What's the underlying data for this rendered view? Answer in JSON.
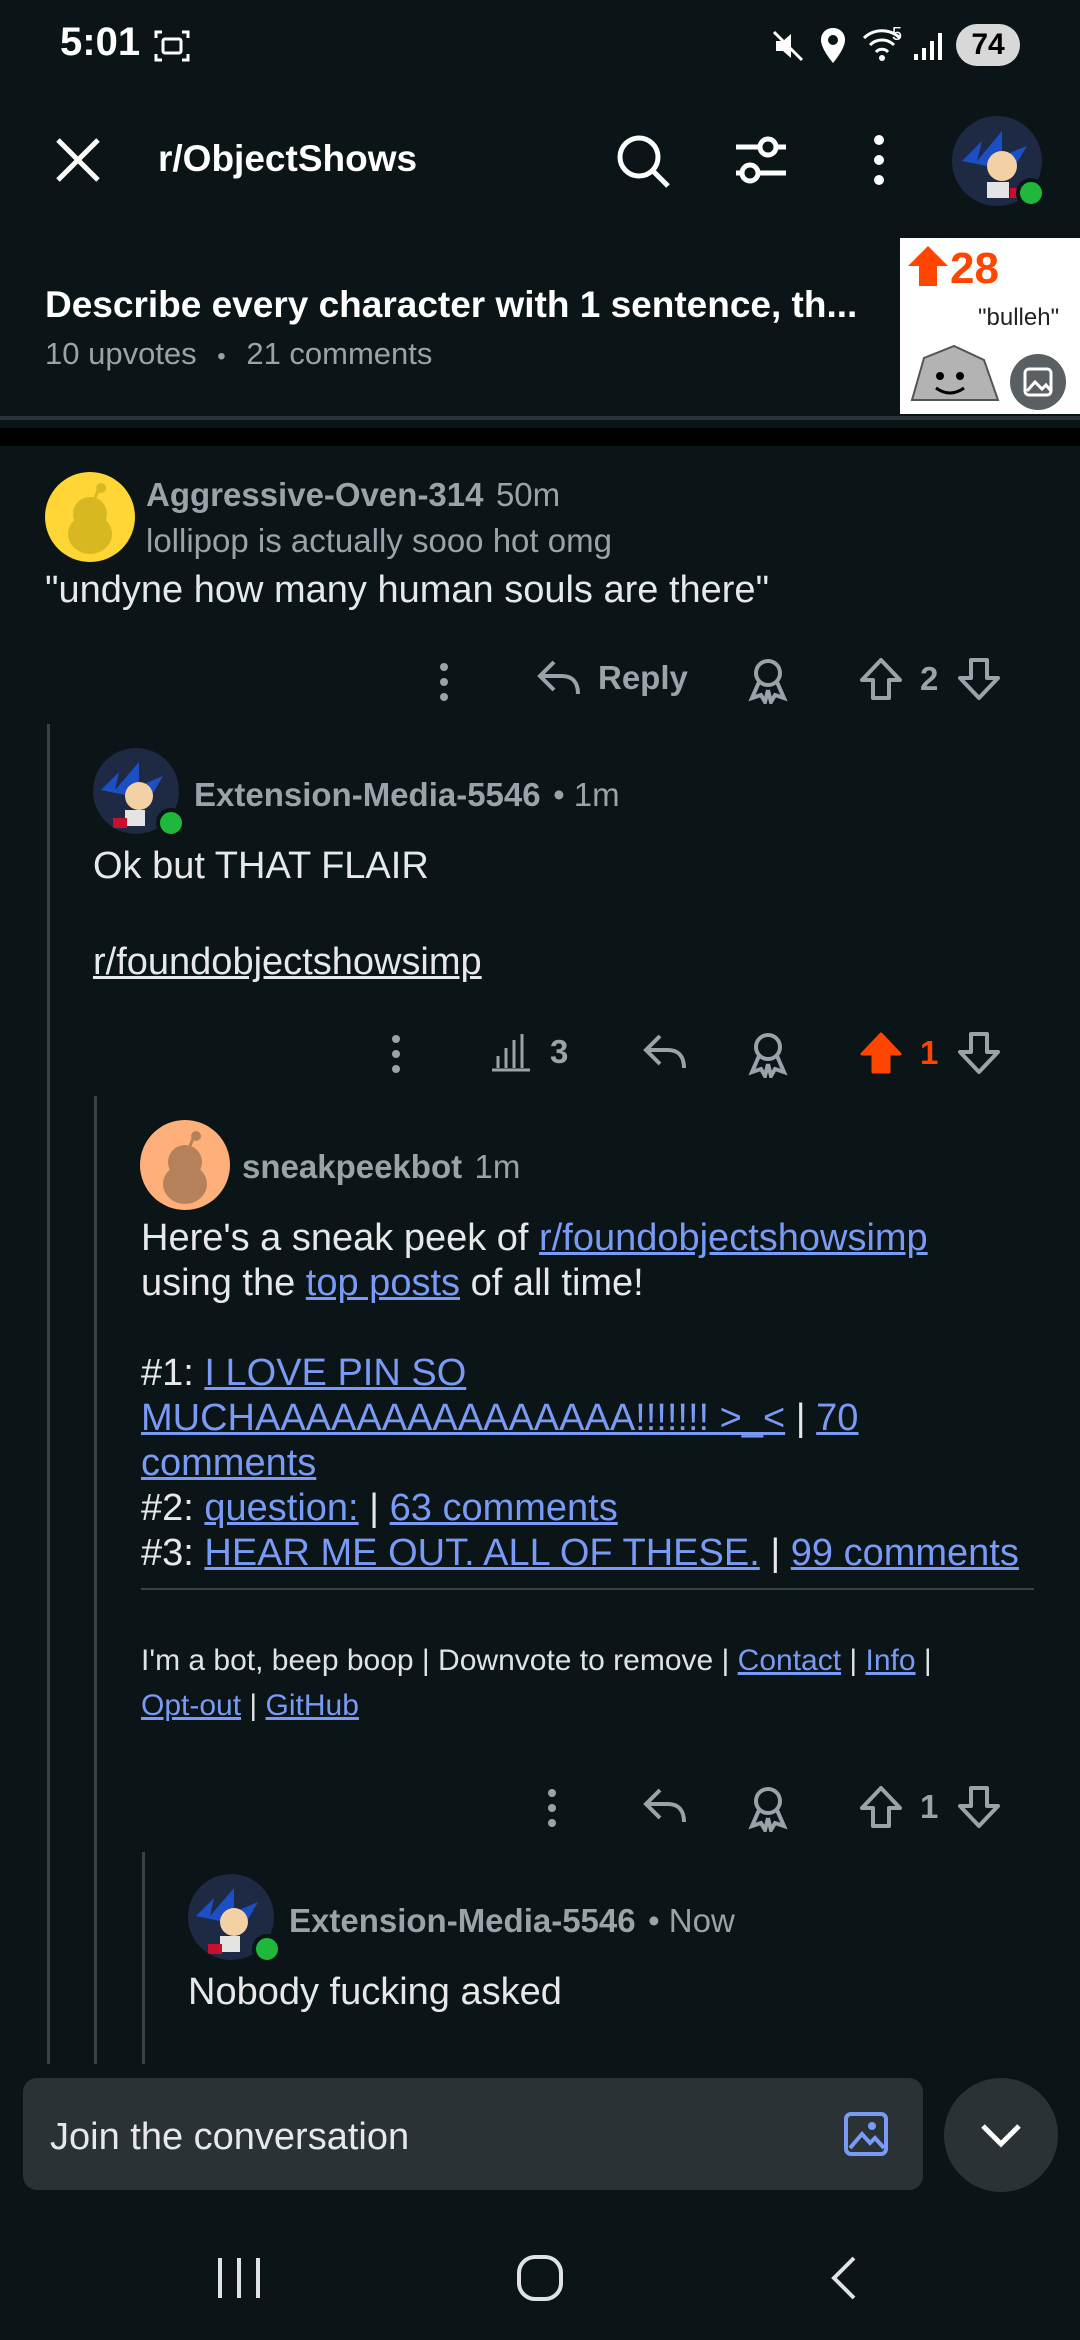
{
  "status_bar": {
    "time": "5:01",
    "battery": "74",
    "network_label": "5"
  },
  "app_bar": {
    "subreddit": "r/ObjectShows"
  },
  "post": {
    "title": "Describe every character with 1 sentence, th...",
    "upvotes": "10 upvotes",
    "separator": "•",
    "comments": "21 comments",
    "thumbnail_score": "28",
    "thumbnail_caption": "\"bulleh\""
  },
  "comments": [
    {
      "username": "Aggressive-Oven-314",
      "time": "50m",
      "flair": "lollipop is actually sooo hot omg",
      "body": "\"undyne how many human souls are there\"",
      "reply_label": "Reply",
      "votes": "2"
    },
    {
      "username": "Extension-Media-5546",
      "time": "• 1m",
      "body_line1": "Ok but THAT FLAIR",
      "body_link": "r/foundobjectshowsimp",
      "stats": "3",
      "votes": "1"
    },
    {
      "username": "sneakpeekbot",
      "time": "1m",
      "intro_pre": "Here's a sneak peek of ",
      "intro_link": "r/foundobjectshowsimp",
      "intro_mid_pre": "using the ",
      "intro_mid_link": "top posts",
      "intro_mid_post": " of all time!",
      "items": [
        {
          "num": "#1: ",
          "title": "I LOVE PIN SO MUCHAAAAAAAAAAAAAAA!!!!!!! >_<",
          "sep": " | ",
          "comments": "70 comments"
        },
        {
          "num": "#2: ",
          "title": "question:",
          "sep": " | ",
          "comments": "63 comments"
        },
        {
          "num": "#3: ",
          "title": "HEAR ME OUT. ALL OF THESE.",
          "sep": " | ",
          "comments": "99 comments"
        }
      ],
      "footer_pre": "I'm a bot, beep boop | Downvote to remove | ",
      "footer_contact": "Contact",
      "footer_sep": " | ",
      "footer_info": "Info",
      "footer_optout": "Opt-out",
      "footer_github": "GitHub",
      "votes": "1"
    },
    {
      "username": "Extension-Media-5546",
      "time": "• Now",
      "body": "Nobody fucking asked"
    }
  ],
  "composer": {
    "placeholder": "Join the conversation"
  },
  "colors": {
    "background": "#0b1416",
    "upvote_active": "#ff4500",
    "link": "#7a9bf5",
    "online": "#1fb83c"
  }
}
